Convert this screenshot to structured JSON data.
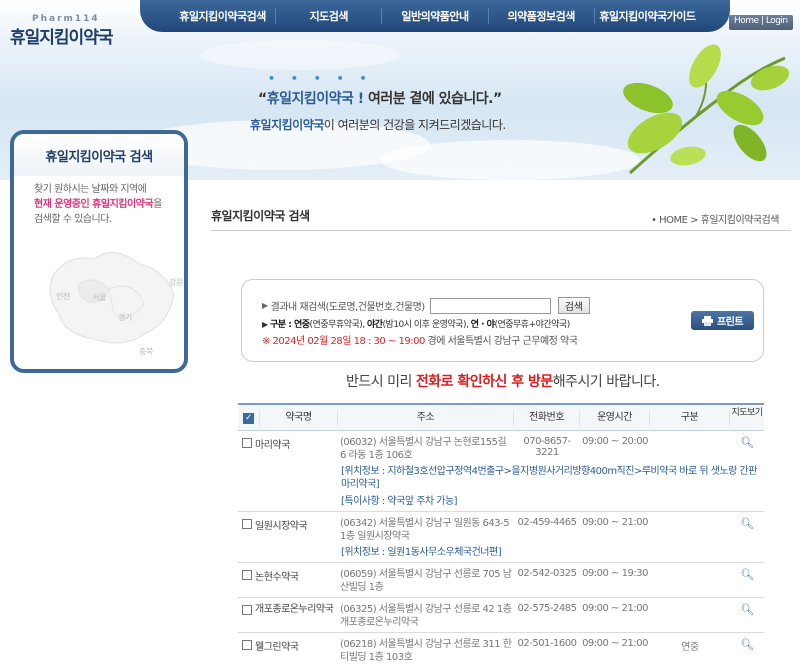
{
  "header": {
    "logo_en": "Pharm114",
    "logo_kr": "휴일지킴이약국",
    "nav": [
      "휴일지킴이약국검색",
      "지도검색",
      "일반의약품안내",
      "의약품정보검색",
      "휴일지킴이약국가이드"
    ],
    "home_login": "Home | Login"
  },
  "banner": {
    "dots": "• • • • •",
    "slogan_open": "“",
    "slogan_highlight": "휴일지킴이약국 !",
    "slogan_rest": " 여러분 곁에 있습니다.”",
    "slogan2_bold": "휴일지킴이약국",
    "slogan2_rest": "이 여러분의 건강을 지켜드리겠습니다."
  },
  "sidebar": {
    "title": "휴일지킴이약국 검색",
    "desc1": "찾기 원하시는 날짜와 지역에",
    "desc2": "현재 운영중인 휴일지킴이약국",
    "desc2b": "을",
    "desc3": "검색할 수 있습니다.",
    "map_labels": [
      "인천",
      "서울",
      "경기",
      "강원",
      "충북"
    ]
  },
  "page": {
    "title": "휴일지킴이약국 검색",
    "breadcrumb": "• HOME > 휴일지킴이약국검색"
  },
  "search": {
    "label": "결과내 재검색(도로명,건물번호,건물명)",
    "input_value": "",
    "button": "검색",
    "legend_prefix": "구분 : ",
    "legend_b1": "연중",
    "legend_t1": "(연중무휴약국), ",
    "legend_b2": "야간",
    "legend_t2": "(밤10시 이후 운영약국), ",
    "legend_b3": "연 · 야",
    "legend_t3": "(연중무휴+야간약국)",
    "date_notice": "※ 2024년 02월 28일 18 : 30 ~ 19:00",
    "date_rest": " 경에  서울특별시  강남구   근무예정 약국",
    "print": "프린트"
  },
  "notice": {
    "pre": "반드시 미리 ",
    "red1": "전화로 확인하신 후 방문",
    "post": "해주시기 바랍니다."
  },
  "table": {
    "headers": [
      "약국명",
      "주소",
      "전화번호",
      "운영시간",
      "구분",
      "지도보기"
    ],
    "rows": [
      {
        "name": "마리약국",
        "address": "(06032) 서울특별시 강남구 논현로155길 6 라동 1층 106호",
        "phone": "070-8657-3221",
        "time": "09:00 ~ 20:00",
        "type": "",
        "location": "[위치정보 : 지하철3호선압구정역4번출구>을지병원사거리방향400m직진>루비약국 바로 뒤 샛노랑 간판 마리약국]",
        "special": "[특이사항 : 약국앞 주차 가능]"
      },
      {
        "name": "일원시장약국",
        "address": "(06342) 서울특별시 강남구 일원동 643-5 1층 일원시장약국",
        "phone": "02-459-4465",
        "time": "09:00 ~ 21:00",
        "type": "",
        "location": "[위치정보 : 일원1동사무소우체국건너편]",
        "special": ""
      },
      {
        "name": "논현수약국",
        "address": "(06059) 서울특별시 강남구 선릉로 705 남산빌딩 1층",
        "phone": "02-542-0325",
        "time": "09:00 ~ 19:30",
        "type": "",
        "location": "",
        "special": ""
      },
      {
        "name": "개포종로온누리약국",
        "address": "(06325) 서울특별시 강남구 선릉로 42 1층 개포종로온누리약국",
        "phone": "02-575-2485",
        "time": "09:00 ~ 21:00",
        "type": "",
        "location": "",
        "special": ""
      },
      {
        "name": "웰그린약국",
        "address": "(06218) 서울특별시 강남구 선릉로 311 한티빌딩 1층 103호",
        "phone": "02-501-1600",
        "time": "09:00 ~ 21:00",
        "type": "연중",
        "location": "",
        "special": ""
      }
    ]
  }
}
